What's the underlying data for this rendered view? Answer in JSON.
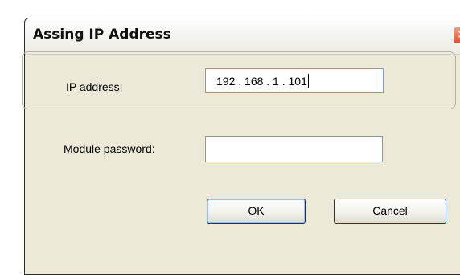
{
  "dialog": {
    "title": "Assing IP Address",
    "close_glyph": "✕"
  },
  "form": {
    "ip_label": "IP address:",
    "ip_value": "192 . 168 .  1  . 101",
    "password_label": "Module password:",
    "password_value": ""
  },
  "buttons": {
    "ok_label": "OK",
    "cancel_label": "Cancel"
  },
  "icons": {
    "close": "close-icon"
  }
}
